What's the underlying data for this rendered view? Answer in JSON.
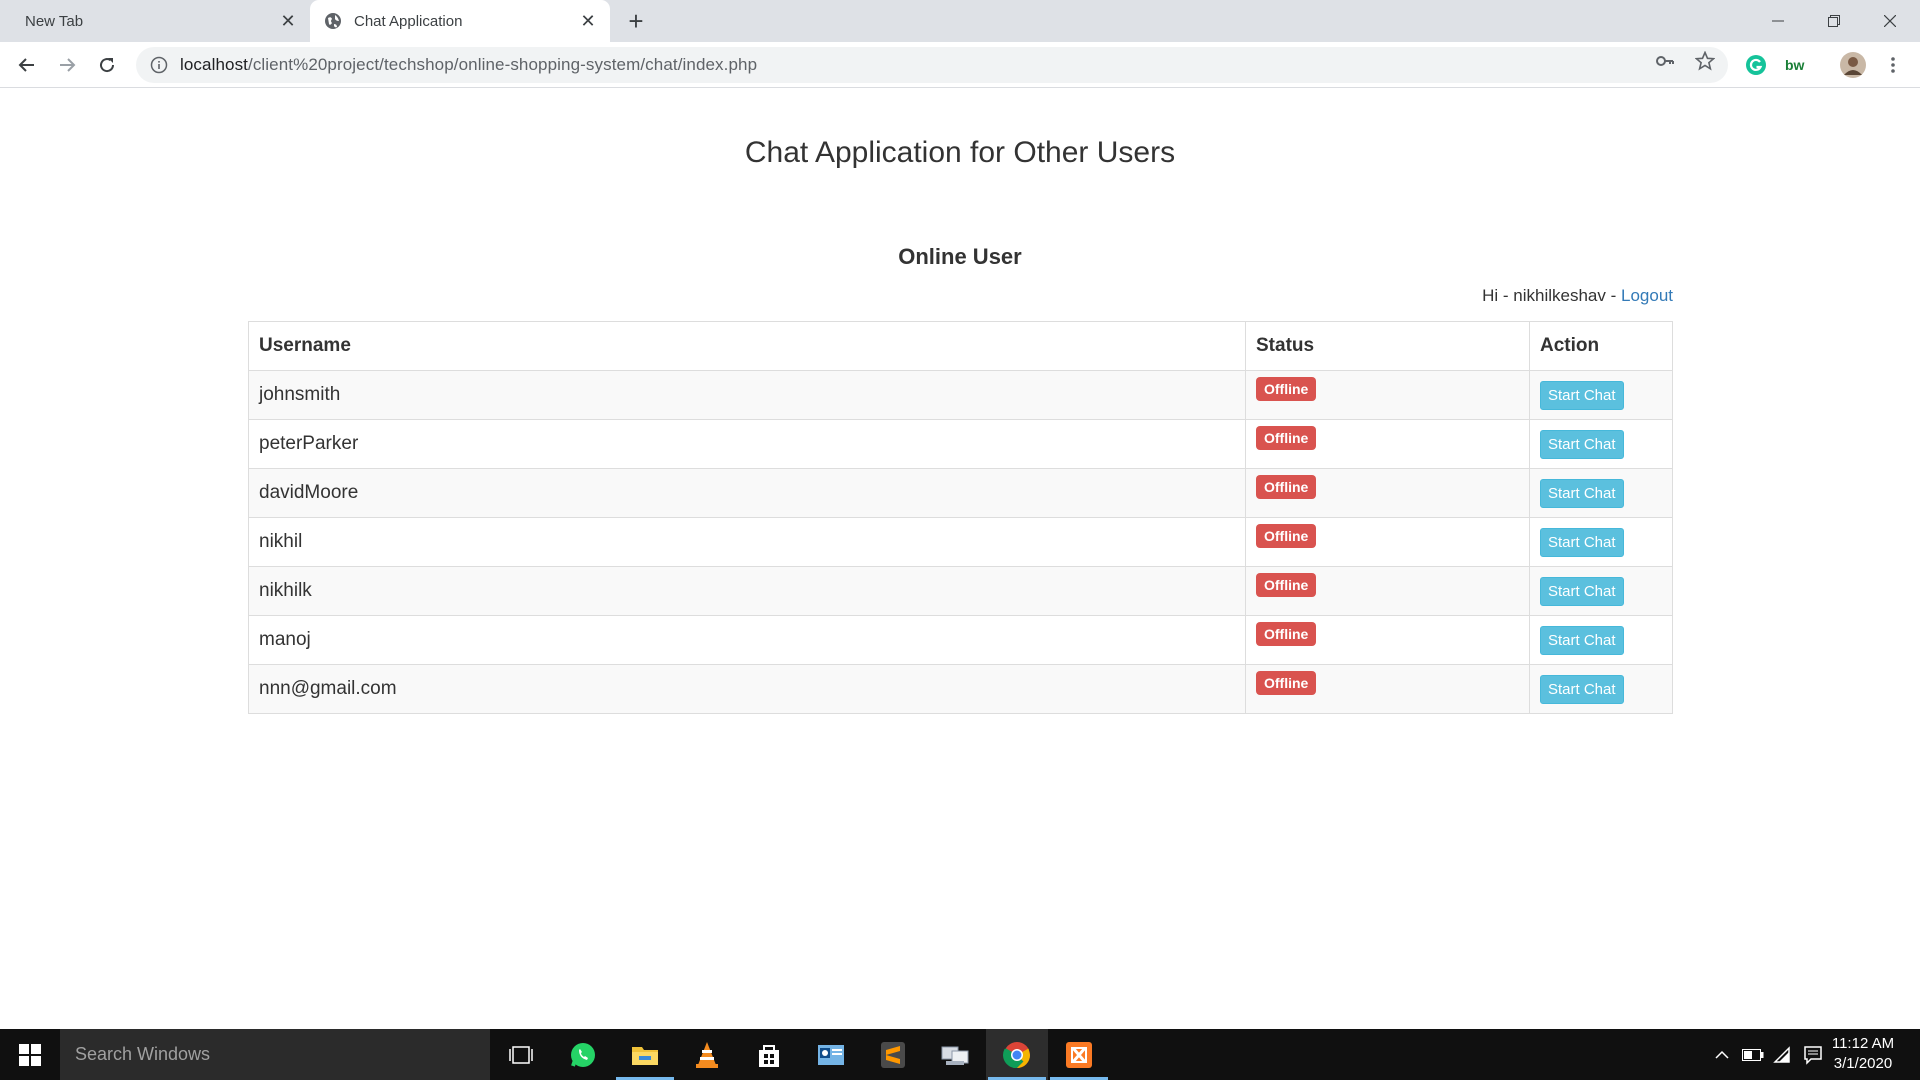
{
  "browser": {
    "tabs": [
      {
        "title": "New Tab"
      },
      {
        "title": "Chat Application"
      }
    ],
    "url_host": "localhost",
    "url_path": "/client%20project/techshop/online-shopping-system/chat/index.php"
  },
  "page": {
    "title": "Chat Application for Other Users",
    "section_title": "Online User",
    "greeting": "Hi - nikhilkeshav - ",
    "logout_label": "Logout"
  },
  "table": {
    "headers": [
      "Username",
      "Status",
      "Action"
    ],
    "rows": [
      {
        "username": "johnsmith",
        "status": "Offline",
        "action": "Start Chat"
      },
      {
        "username": "peterParker",
        "status": "Offline",
        "action": "Start Chat"
      },
      {
        "username": "davidMoore",
        "status": "Offline",
        "action": "Start Chat"
      },
      {
        "username": "nikhil",
        "status": "Offline",
        "action": "Start Chat"
      },
      {
        "username": "nikhilk",
        "status": "Offline",
        "action": "Start Chat"
      },
      {
        "username": "manoj",
        "status": "Offline",
        "action": "Start Chat"
      },
      {
        "username": "nnn@gmail.com",
        "status": "Offline",
        "action": "Start Chat"
      }
    ]
  },
  "taskbar": {
    "search_placeholder": "Search Windows",
    "apps": [
      "task-view",
      "whatsapp",
      "file-explorer",
      "vlc",
      "store",
      "outlook",
      "sublime-text",
      "network",
      "chrome",
      "xampp"
    ],
    "time": "11:12 AM",
    "date": "3/1/2020"
  },
  "colors": {
    "badge_offline": "#d9534f",
    "button_info": "#5bc0de",
    "link": "#337ab7"
  }
}
